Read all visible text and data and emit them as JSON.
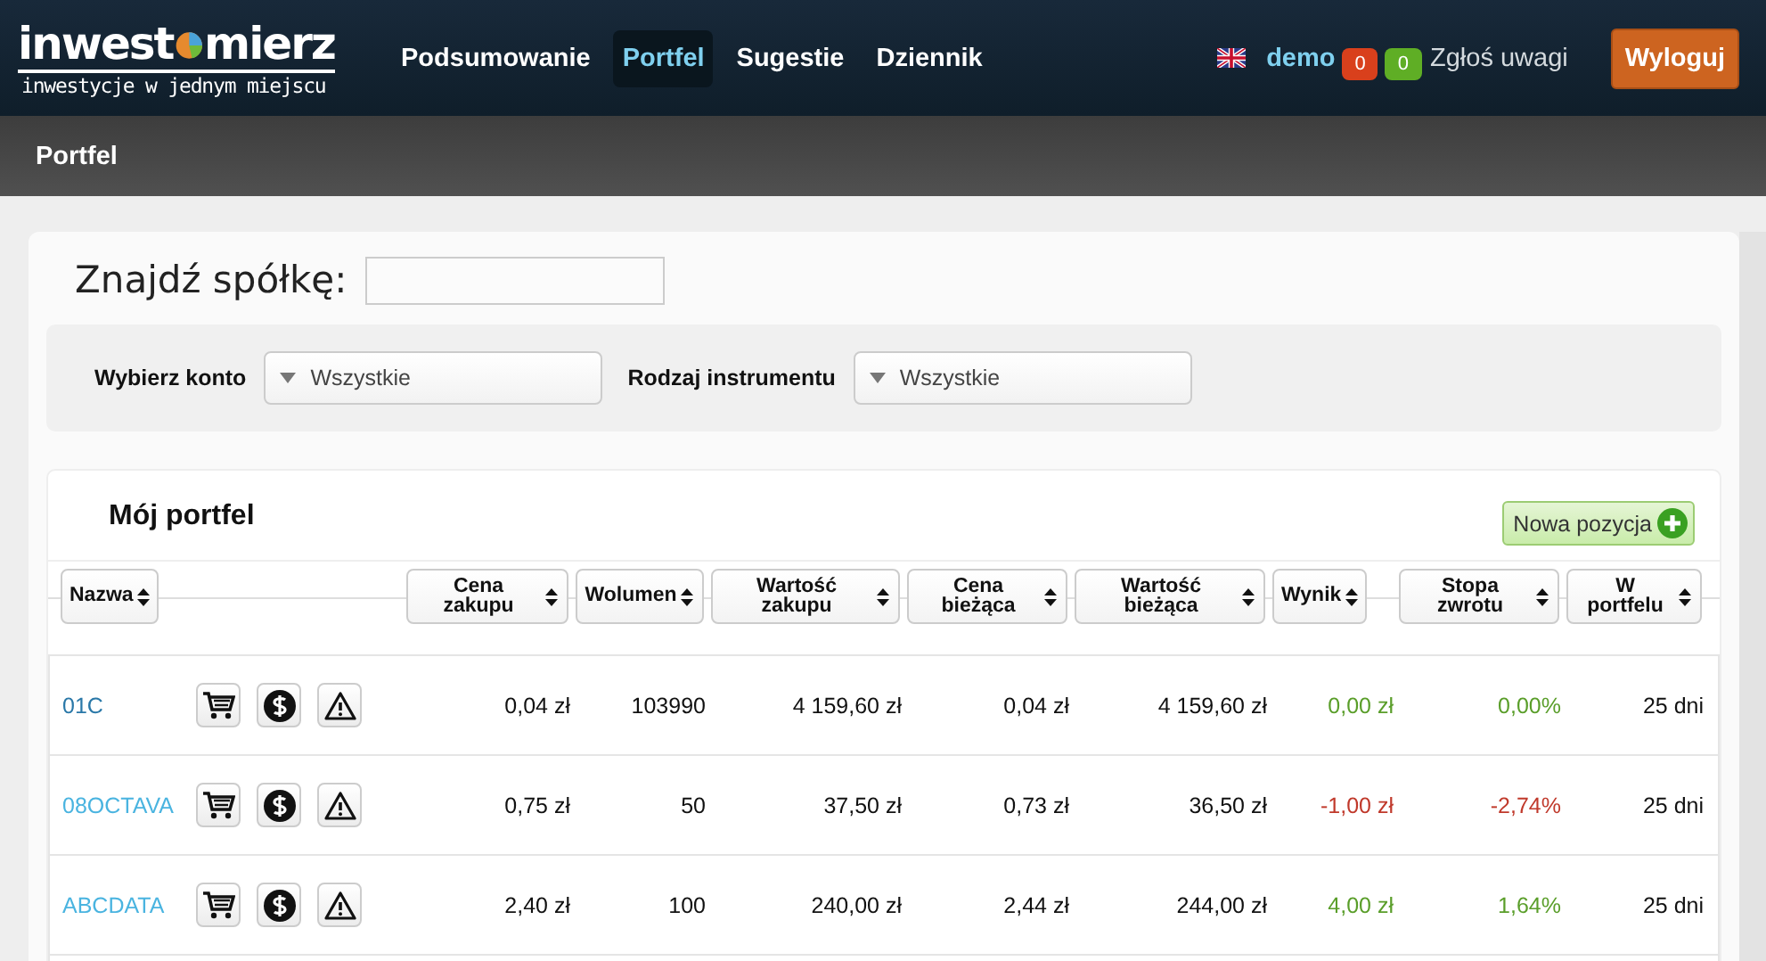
{
  "logo": {
    "before": "inwest",
    "after": "mierz",
    "tagline": "inwestycje w jednym miejscu"
  },
  "nav": [
    {
      "label": "Podsumowanie",
      "selected": false
    },
    {
      "label": "Portfel",
      "selected": true
    },
    {
      "label": "Sugestie",
      "selected": false
    },
    {
      "label": "Dziennik",
      "selected": false
    }
  ],
  "user": {
    "name": "demo",
    "badges": [
      {
        "count": "0",
        "color": "#d9401c"
      },
      {
        "count": "0",
        "color": "#5fae25"
      }
    ],
    "feedback": "Zgłoś uwagi",
    "logout": "Wyloguj"
  },
  "page_title": "Portfel",
  "search": {
    "label": "Znajdź spółkę:"
  },
  "filters": [
    {
      "label": "Wybierz konto",
      "value": "Wszystkie"
    },
    {
      "label": "Rodzaj instrumentu",
      "value": "Wszystkie"
    }
  ],
  "portfolio": {
    "title": "Mój portfel",
    "add_button": "Nowa pozycja",
    "columns": [
      "Nazwa",
      "",
      "Cena zakupu",
      "Wolumen",
      "Wartość zakupu",
      "Cena bieżąca",
      "Wartość bieżąca",
      "Wynik",
      "Stopa zwrotu",
      "W portfelu"
    ],
    "rows": [
      {
        "name": "01C",
        "cells": [
          "0,04 zł",
          "103990",
          "4 159,60 zł",
          "0,04 zł",
          "4 159,60 zł"
        ],
        "result": "0,00 zł",
        "return": "0,00%",
        "color": "#5a9e2a",
        "days": "25 dni"
      },
      {
        "name": "08OCTAVA",
        "cells": [
          "0,75 zł",
          "50",
          "37,50 zł",
          "0,73 zł",
          "36,50 zł"
        ],
        "result": "-1,00 zł",
        "return": "-2,74%",
        "color": "#c0392b",
        "days": "25 dni"
      },
      {
        "name": "ABCDATA",
        "cells": [
          "2,40 zł",
          "100",
          "240,00 zł",
          "2,44 zł",
          "244,00 zł"
        ],
        "result": "4,00 zł",
        "return": "1,64%",
        "color": "#5a9e2a",
        "days": "25 dni"
      }
    ]
  }
}
